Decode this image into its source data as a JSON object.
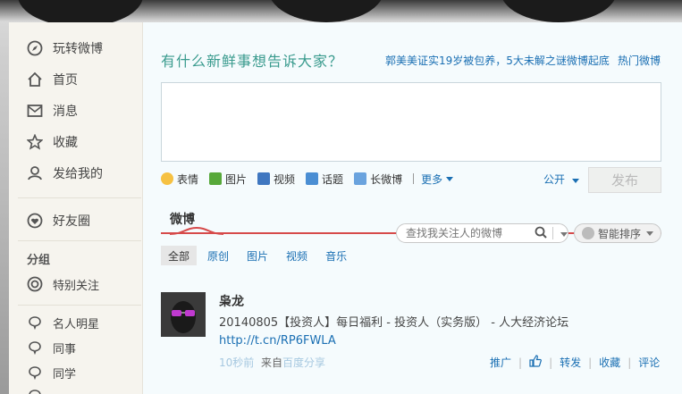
{
  "nav": {
    "items": [
      {
        "label": "玩转微博",
        "icon": "compass-icon"
      },
      {
        "label": "首页",
        "icon": "home-icon"
      },
      {
        "label": "消息",
        "icon": "mail-icon"
      },
      {
        "label": "收藏",
        "icon": "star-icon"
      },
      {
        "label": "发给我的",
        "icon": "user-icon"
      }
    ],
    "friends": {
      "label": "好友圈",
      "icon": "heart-icon"
    },
    "group_heading": "分组",
    "special": {
      "label": "特别关注",
      "icon": "target-icon"
    },
    "groups": [
      {
        "label": "名人明星"
      },
      {
        "label": "同事"
      },
      {
        "label": "同学"
      }
    ]
  },
  "composer": {
    "prompt": "有什么新鲜事想告诉大家？",
    "hot_topic": "郭美美证实19岁被包养，5大未解之谜微博起底",
    "hot_link": "热门微博",
    "tools": [
      "表情",
      "图片",
      "视频",
      "话题",
      "长微博"
    ],
    "more": "更多",
    "visibility": "公开",
    "publish": "发布"
  },
  "feed": {
    "title": "微博",
    "search_placeholder": "查找我关注人的微博",
    "sort_label": "智能排序",
    "filters": [
      "全部",
      "原创",
      "图片",
      "视频",
      "音乐"
    ]
  },
  "post": {
    "author": "枭龙",
    "text": "20140805【投资人】每日福利 - 投资人（实务版） - 人大经济论坛",
    "link": "http://t.cn/RP6FWLA",
    "time": "10秒前",
    "from_prefix": "来自",
    "from_source": "百度分享",
    "actions": [
      "推广",
      "转发",
      "收藏",
      "评论"
    ]
  },
  "colors": {
    "accent": "#1a6fb3",
    "prompt": "#3a9b8e",
    "feed_line": "#d64a4a"
  }
}
